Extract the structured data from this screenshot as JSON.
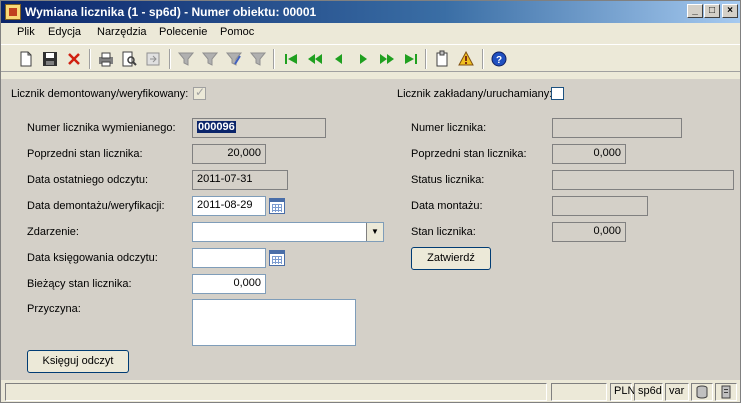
{
  "window": {
    "title": "Wymiana licznika (1 - sp6d) - Numer obiektu: 00001",
    "controls": {
      "minimize": "_",
      "maximize": "□",
      "close": "×"
    }
  },
  "menu": [
    "Plik",
    "Edycja",
    "Narzędzia",
    "Polecenie",
    "Pomoc"
  ],
  "toolbar": {
    "icons": [
      "new-icon",
      "save-icon",
      "delete-icon",
      "print-icon",
      "print-preview-icon",
      "export-icon",
      "filter-icon",
      "filter-field-icon",
      "filter-edit-icon",
      "filter-clear-icon",
      "first-record-icon",
      "previous-page-icon",
      "previous-record-icon",
      "next-record-icon",
      "next-page-icon",
      "last-record-icon",
      "clipboard-icon",
      "alert-icon",
      "help-icon"
    ]
  },
  "left": {
    "dismounted_label": "Licznik demontowany/weryfikowany:",
    "dismounted_checked": true,
    "old_meter_number_label": "Numer licznika wymienianego:",
    "old_meter_number_value": "000096",
    "previous_reading_label": "Poprzedni stan licznika:",
    "previous_reading_value": "20,000",
    "last_reading_date_label": "Data ostatniego odczytu:",
    "last_reading_date_value": "2011-07-31",
    "dismount_date_label": "Data demontażu/weryfikacji:",
    "dismount_date_value": "2011-08-29",
    "event_label": "Zdarzenie:",
    "event_value": "",
    "posting_date_label": "Data księgowania odczytu:",
    "posting_date_value": "",
    "current_reading_label": "Bieżący stan licznika:",
    "current_reading_value": "0,000",
    "reason_label": "Przyczyna:",
    "reason_value": "",
    "post_button": "Księguj odczyt"
  },
  "right": {
    "installed_label": "Licznik zakładany/uruchamiany:",
    "installed_checked": false,
    "meter_number_label": "Numer licznika:",
    "meter_number_value": "",
    "previous_reading_label": "Poprzedni stan licznika:",
    "previous_reading_value": "0,000",
    "status_label": "Status licznika:",
    "status_value": "",
    "install_date_label": "Data montażu:",
    "install_date_value": "",
    "meter_reading_label": "Stan licznika:",
    "meter_reading_value": "0,000",
    "confirm_button": "Zatwierdź"
  },
  "statusbar": {
    "currency": "PLN",
    "company": "sp6d",
    "user": "var"
  }
}
